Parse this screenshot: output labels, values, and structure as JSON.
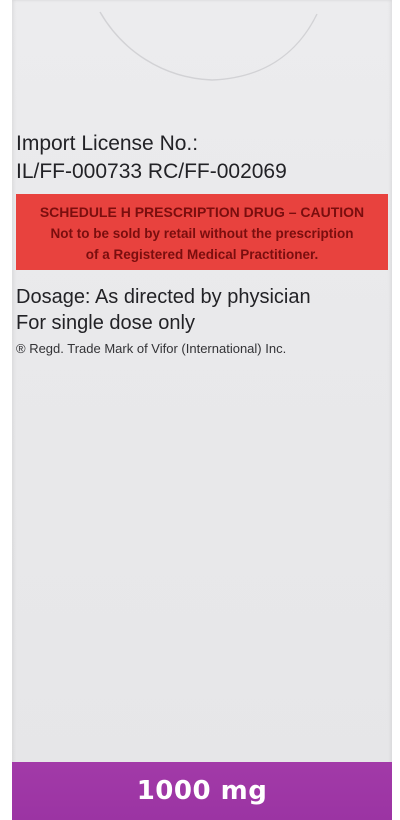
{
  "import_license": {
    "label": "Import License No.:",
    "number": "IL/FF-000733 RC/FF-002069"
  },
  "schedule_warning": {
    "title": "SCHEDULE H PRESCRIPTION DRUG – CAUTION",
    "line1": "Not to be sold by retail without the prescription",
    "line2": "of a Registered Medical Practitioner.",
    "background_color": "#e8423e",
    "text_color": "#7a0e0e"
  },
  "dosage": {
    "instruction": "Dosage: As directed by physician",
    "usage": "For single dose only"
  },
  "trademark": "® Regd. Trade Mark of Vifor (International) Inc.",
  "strength": {
    "label": "1000 mg",
    "band_color": "#9e37a5"
  },
  "packaging_color": "#e9e9eb"
}
